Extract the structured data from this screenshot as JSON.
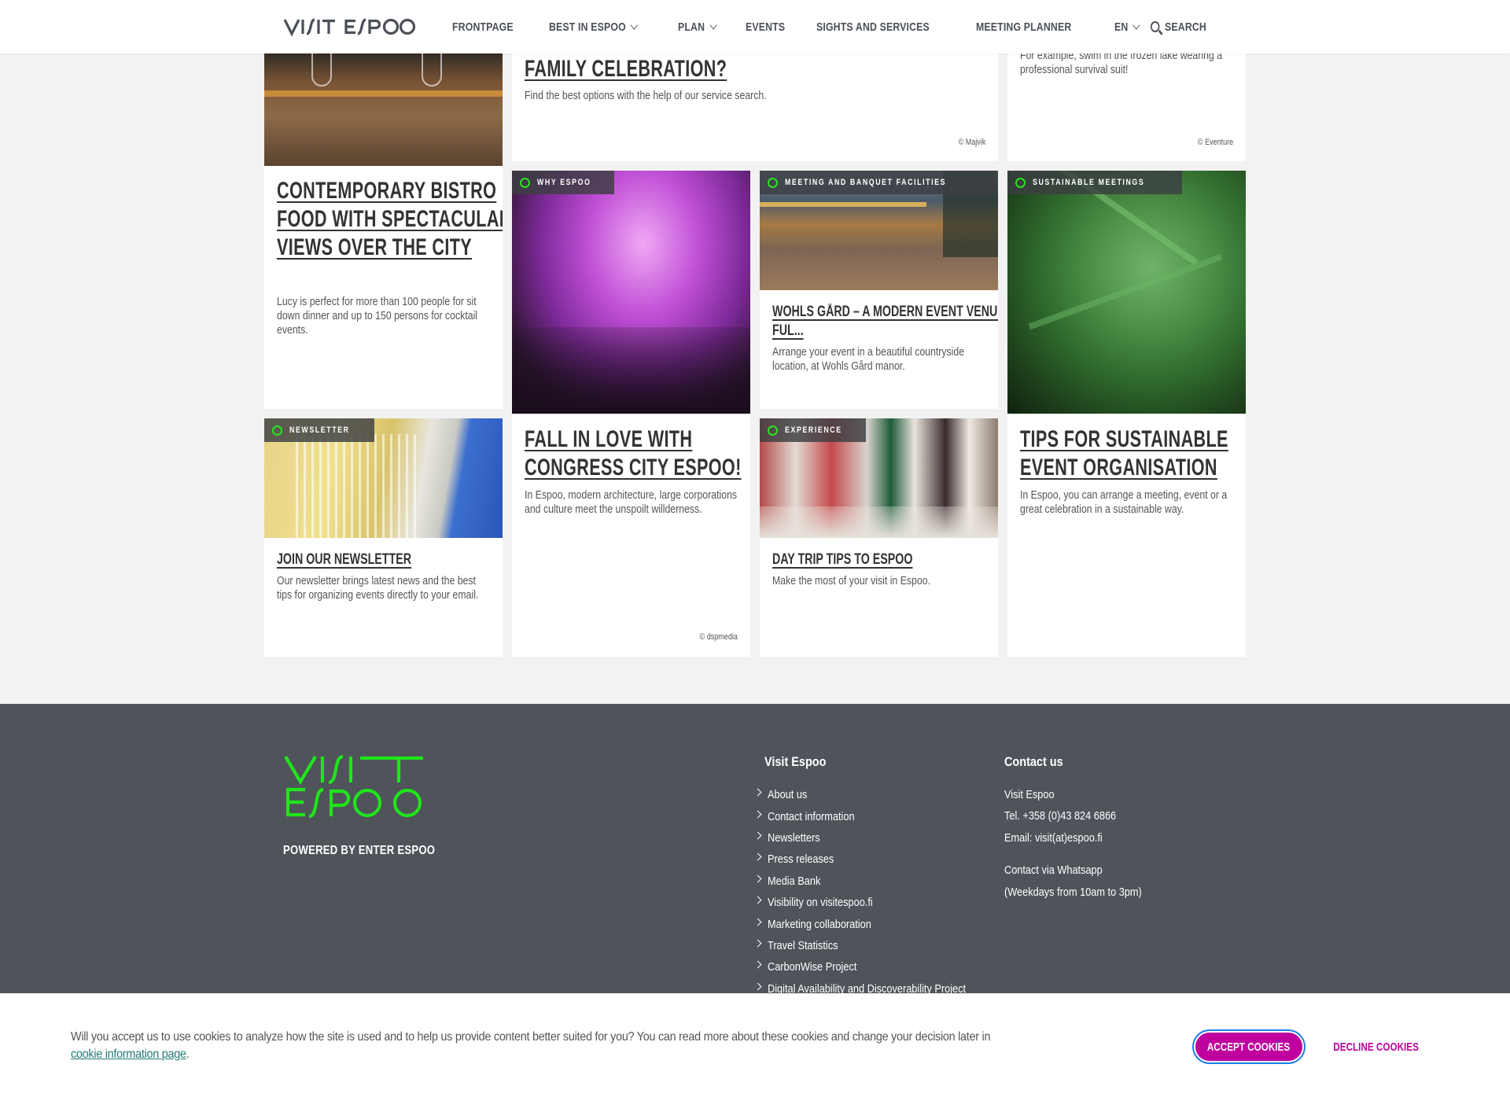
{
  "header": {
    "logo_text": "VISIT ESPOO",
    "nav": [
      {
        "label": "FRONTPAGE",
        "dropdown": false
      },
      {
        "label": "BEST IN ESPOO",
        "dropdown": true
      },
      {
        "label": "PLAN",
        "dropdown": true
      },
      {
        "label": "EVENTS",
        "dropdown": false
      },
      {
        "label": "SIGHTS AND SERVICES",
        "dropdown": false
      },
      {
        "label": "MEETING PLANNER",
        "dropdown": false
      },
      {
        "label": "EN",
        "dropdown": true
      }
    ],
    "search_label": "SEARCH"
  },
  "cards": {
    "bistro": {
      "title": "CONTEMPORARY BISTRO FOOD WITH SPECTACULAR VIEWS OVER THE CITY",
      "desc": "Lucy is perfect for more than 100 people for sit down dinner and up to 150 persons for cocktail events."
    },
    "family": {
      "title": "FAMILY CELEBRATION?",
      "desc": "Find the best options with the help of our service search.",
      "credit": "© Majvik"
    },
    "survival": {
      "desc": "For example, swim in the frozen lake wearing a professional survival suit!",
      "credit": "© Eventure"
    },
    "why_espoo": {
      "tag": "WHY ESPOO"
    },
    "wohls": {
      "tag": "MEETING AND BANQUET FACILITIES",
      "title": "WOHLS GÅRD – A MODERN EVENT VENUE FUL...",
      "desc": "Arrange your event in a beautiful countryside location, at Wohls Gård manor."
    },
    "sustainable_img": {
      "tag": "SUSTAINABLE MEETINGS"
    },
    "newsletter": {
      "tag": "NEWSLETTER",
      "title": "JOIN OUR NEWSLETTER",
      "desc": "Our newsletter brings latest news and the best tips for organizing events directly to your email."
    },
    "congress": {
      "title": "FALL IN LOVE WITH CONGRESS CITY ESPOO!",
      "desc": "In Espoo, modern architecture, large corporations and culture meet the unspoilt willderness.",
      "credit": "© dspmedia"
    },
    "daytrip": {
      "tag": "EXPERIENCE",
      "title": "DAY TRIP TIPS TO ESPOO",
      "desc": "Make the most of your visit in Espoo."
    },
    "sustainable": {
      "title": "TIPS FOR SUSTAINABLE EVENT ORGANISATION",
      "desc": "In Espoo, you can arrange a meeting, event or a great celebration in a sustainable way."
    }
  },
  "footer": {
    "logo_text": "VISIT ESPOO",
    "powered": "POWERED BY ENTER ESPOO",
    "links_heading": "Visit Espoo",
    "links": [
      "About us",
      "Contact information",
      "Newsletters",
      "Press releases",
      "Media Bank",
      "Visibility on visitespoo.fi",
      "Marketing collaboration",
      "Travel Statistics",
      "CarbonWise Project",
      "Digital Availability and Discoverability Project"
    ],
    "contact_heading": "Contact us",
    "contact": {
      "name": "Visit Espoo",
      "tel": "Tel. +358 (0)43 824 6866",
      "email": "Email: visit(at)espoo.fi",
      "whatsapp": "Contact via Whatsapp",
      "hours": "(Weekdays from 10am to 3pm)"
    }
  },
  "cookie": {
    "text": "Will you accept us to use cookies to analyze how the site is used and to help us provide content better suited for you? You can read more about these cookies and change your decision later in ",
    "link": "cookie information page",
    "text_end": ".",
    "accept": "ACCEPT COOKIES",
    "decline": "DECLINE COOKIES"
  },
  "colors": {
    "accent_green": "#27e41e",
    "cookie_magenta": "#c0009e",
    "footer_bg": "#4f535a",
    "page_bg": "#f2f2f2"
  }
}
